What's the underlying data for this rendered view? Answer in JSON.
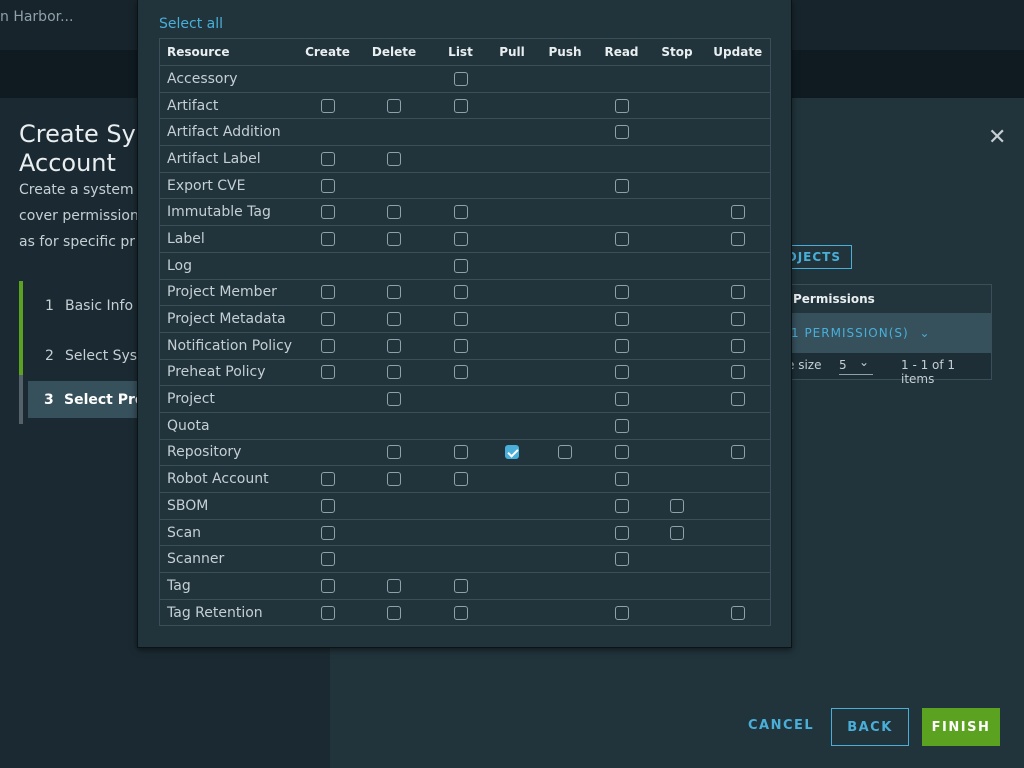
{
  "app": {
    "brand_fragment": "n Harbor..."
  },
  "wizard": {
    "title": "Create System Account",
    "title_visible": "Create Sys\nAccount",
    "description_visible": "Create a system\ncover permission\nas for specific pr",
    "steps": [
      {
        "num": "1",
        "label": "Basic Info"
      },
      {
        "num": "2",
        "label": "Select Sys"
      },
      {
        "num": "3",
        "label": "Select Pro"
      }
    ],
    "projects_button": "OJECTS",
    "permissions_header": "Permissions",
    "permissions_row": "1 PERMISSION(S)",
    "page_size_label": "e size",
    "page_size_value": "5",
    "items_count": "1 - 1 of 1 items",
    "cancel": "CANCEL",
    "back": "BACK",
    "finish": "FINISH"
  },
  "popover": {
    "select_all": "Select all",
    "columns": [
      "Resource",
      "Create",
      "Delete",
      "List",
      "Pull",
      "Push",
      "Read",
      "Stop",
      "Update"
    ],
    "rows": [
      {
        "name": "Accessory",
        "cells": [
          null,
          null,
          false,
          null,
          null,
          null,
          null,
          null
        ]
      },
      {
        "name": "Artifact",
        "cells": [
          false,
          false,
          false,
          null,
          null,
          false,
          null,
          null
        ]
      },
      {
        "name": "Artifact Addition",
        "cells": [
          null,
          null,
          null,
          null,
          null,
          false,
          null,
          null
        ]
      },
      {
        "name": "Artifact Label",
        "cells": [
          false,
          false,
          null,
          null,
          null,
          null,
          null,
          null
        ]
      },
      {
        "name": "Export CVE",
        "cells": [
          false,
          null,
          null,
          null,
          null,
          false,
          null,
          null
        ]
      },
      {
        "name": "Immutable Tag",
        "cells": [
          false,
          false,
          false,
          null,
          null,
          null,
          null,
          false
        ]
      },
      {
        "name": "Label",
        "cells": [
          false,
          false,
          false,
          null,
          null,
          false,
          null,
          false
        ]
      },
      {
        "name": "Log",
        "cells": [
          null,
          null,
          false,
          null,
          null,
          null,
          null,
          null
        ]
      },
      {
        "name": "Project Member",
        "cells": [
          false,
          false,
          false,
          null,
          null,
          false,
          null,
          false
        ]
      },
      {
        "name": "Project Metadata",
        "cells": [
          false,
          false,
          false,
          null,
          null,
          false,
          null,
          false
        ]
      },
      {
        "name": "Notification Policy",
        "cells": [
          false,
          false,
          false,
          null,
          null,
          false,
          null,
          false
        ]
      },
      {
        "name": "Preheat Policy",
        "cells": [
          false,
          false,
          false,
          null,
          null,
          false,
          null,
          false
        ]
      },
      {
        "name": "Project",
        "cells": [
          null,
          false,
          null,
          null,
          null,
          false,
          null,
          false
        ]
      },
      {
        "name": "Quota",
        "cells": [
          null,
          null,
          null,
          null,
          null,
          false,
          null,
          null
        ]
      },
      {
        "name": "Repository",
        "cells": [
          null,
          false,
          false,
          true,
          false,
          false,
          null,
          false
        ]
      },
      {
        "name": "Robot Account",
        "cells": [
          false,
          false,
          false,
          null,
          null,
          false,
          null,
          null
        ]
      },
      {
        "name": "SBOM",
        "cells": [
          false,
          null,
          null,
          null,
          null,
          false,
          false,
          null
        ]
      },
      {
        "name": "Scan",
        "cells": [
          false,
          null,
          null,
          null,
          null,
          false,
          false,
          null
        ]
      },
      {
        "name": "Scanner",
        "cells": [
          false,
          null,
          null,
          null,
          null,
          false,
          null,
          null
        ]
      },
      {
        "name": "Tag",
        "cells": [
          false,
          false,
          false,
          null,
          null,
          null,
          null,
          null
        ]
      },
      {
        "name": "Tag Retention",
        "cells": [
          false,
          false,
          false,
          null,
          null,
          false,
          null,
          false
        ]
      }
    ]
  },
  "colors": {
    "accent": "#49afd9",
    "finish_green": "#5aa220",
    "background": "#21333b"
  }
}
